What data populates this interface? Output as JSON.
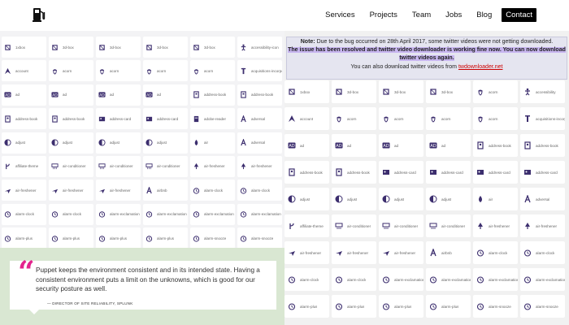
{
  "nav": {
    "links": [
      "Services",
      "Projects",
      "Team",
      "Jobs",
      "Blog"
    ],
    "cta": "Contact"
  },
  "notice": {
    "note_label": "Note:",
    "line1": " Due to the bug occurred on 28th April 2017, some twitter videos were not getting downloaded.",
    "line2": "The issue has been resolved and twitter video downloader is working fine now. You can now download twitter videos again.",
    "line3_prefix": "You can also download twitter videos from ",
    "link_text": "twdownloader.net"
  },
  "quote": {
    "mark": "“",
    "text": "Puppet keeps the environment consistent and in its intended state. Having a consistent environment puts a limit on the unknowns, which is good for our security posture as well.",
    "author": "— DIRECTOR OF SITE RELIABILITY, SPLUNK"
  },
  "icon_color": "#3c2e6e",
  "left_icons": [
    [
      "1xbox",
      "box"
    ],
    [
      "3d-box",
      "box"
    ],
    [
      "3d-box",
      "box"
    ],
    [
      "3d-box",
      "box"
    ],
    [
      "3d-box",
      "box"
    ],
    [
      "accessibility-icon",
      "person"
    ],
    [
      "account",
      "arrow"
    ],
    [
      "acorn",
      "acorn"
    ],
    [
      "acorn",
      "acorn"
    ],
    [
      "acorn",
      "acorn"
    ],
    [
      "acorn",
      "acorn"
    ],
    [
      "acquisitions-incorporated",
      "bar"
    ],
    [
      "ad",
      "ad"
    ],
    [
      "ad",
      "ad"
    ],
    [
      "ad",
      "ad"
    ],
    [
      "ad",
      "ad"
    ],
    [
      "address-book",
      "book"
    ],
    [
      "address-book",
      "book"
    ],
    [
      "address-book",
      "book"
    ],
    [
      "address-book",
      "book"
    ],
    [
      "address-card",
      "card"
    ],
    [
      "address-card",
      "card"
    ],
    [
      "adobe-reader",
      "pdf"
    ],
    [
      "adversal",
      "a"
    ],
    [
      "adjust",
      "half"
    ],
    [
      "adjust",
      "half"
    ],
    [
      "adjust",
      "half"
    ],
    [
      "adjust",
      "half"
    ],
    [
      "air",
      "drop"
    ],
    [
      "adversal",
      "a"
    ],
    [
      "affiliate-theme",
      "branch"
    ],
    [
      "air-conditioner",
      "ac"
    ],
    [
      "air-conditioner",
      "ac"
    ],
    [
      "air-conditioner",
      "ac"
    ],
    [
      "air-freshener",
      "tree"
    ],
    [
      "air-freshener",
      "tree"
    ],
    [
      "air-freshener",
      "plane"
    ],
    [
      "air-freshener",
      "plane"
    ],
    [
      "air-freshener",
      "plane"
    ],
    [
      "airbnb",
      "a"
    ],
    [
      "alarm-clock",
      "clock"
    ],
    [
      "alarm-clock",
      "clock"
    ],
    [
      "alarm-clock",
      "clock"
    ],
    [
      "alarm-clock",
      "clock"
    ],
    [
      "alarm-exclamation",
      "clock"
    ],
    [
      "alarm-exclamation",
      "clock"
    ],
    [
      "alarm-exclamation",
      "clock"
    ],
    [
      "alarm-exclamation",
      "clock"
    ],
    [
      "alarm-plus",
      "clock"
    ],
    [
      "alarm-plus",
      "clock"
    ],
    [
      "alarm-plus",
      "clock"
    ],
    [
      "alarm-plus",
      "clock"
    ],
    [
      "alarm-snooze",
      "clock"
    ],
    [
      "alarm-snooze",
      "clock"
    ]
  ],
  "right_icons": [
    [
      "1xbox",
      "box"
    ],
    [
      "3d-box",
      "box"
    ],
    [
      "3d-box",
      "box"
    ],
    [
      "3d-box",
      "box"
    ],
    [
      "acorn",
      "acorn"
    ],
    [
      "accessibility",
      "person"
    ],
    [
      "account",
      "arrow"
    ],
    [
      "acorn",
      "acorn"
    ],
    [
      "acorn",
      "acorn"
    ],
    [
      "acorn",
      "acorn"
    ],
    [
      "acorn",
      "acorn"
    ],
    [
      "acquisitions-incorporated",
      "bar"
    ],
    [
      "ad",
      "ad"
    ],
    [
      "ad",
      "ad"
    ],
    [
      "ad",
      "ad"
    ],
    [
      "ad",
      "ad"
    ],
    [
      "address-book",
      "book"
    ],
    [
      "address-book",
      "book"
    ],
    [
      "address-book",
      "book"
    ],
    [
      "address-book",
      "book"
    ],
    [
      "address-card",
      "card"
    ],
    [
      "address-card",
      "card"
    ],
    [
      "address-card",
      "card"
    ],
    [
      "address-card",
      "card"
    ],
    [
      "adjust",
      "half"
    ],
    [
      "adjust",
      "half"
    ],
    [
      "adjust",
      "half"
    ],
    [
      "adjust",
      "half"
    ],
    [
      "air",
      "drop"
    ],
    [
      "adversal",
      "a"
    ],
    [
      "affiliate-theme",
      "branch"
    ],
    [
      "air-conditioner",
      "ac"
    ],
    [
      "air-conditioner",
      "ac"
    ],
    [
      "air-conditioner",
      "ac"
    ],
    [
      "air-freshener",
      "tree"
    ],
    [
      "air-freshener",
      "tree"
    ],
    [
      "air-freshener",
      "plane"
    ],
    [
      "air-freshener",
      "plane"
    ],
    [
      "air-freshener",
      "plane"
    ],
    [
      "airbnb",
      "a"
    ],
    [
      "alarm-clock",
      "clock"
    ],
    [
      "alarm-clock",
      "clock"
    ],
    [
      "alarm-clock",
      "clock"
    ],
    [
      "alarm-clock",
      "clock"
    ],
    [
      "alarm-exclamation",
      "clock"
    ],
    [
      "alarm-exclamation",
      "clock"
    ],
    [
      "alarm-exclamation",
      "clock"
    ],
    [
      "alarm-exclamation",
      "clock"
    ],
    [
      "alarm-plus",
      "clock"
    ],
    [
      "alarm-plus",
      "clock"
    ],
    [
      "alarm-plus",
      "clock"
    ],
    [
      "alarm-plus",
      "clock"
    ],
    [
      "alarm-snooze",
      "clock"
    ],
    [
      "alarm-snooze",
      "clock"
    ]
  ]
}
